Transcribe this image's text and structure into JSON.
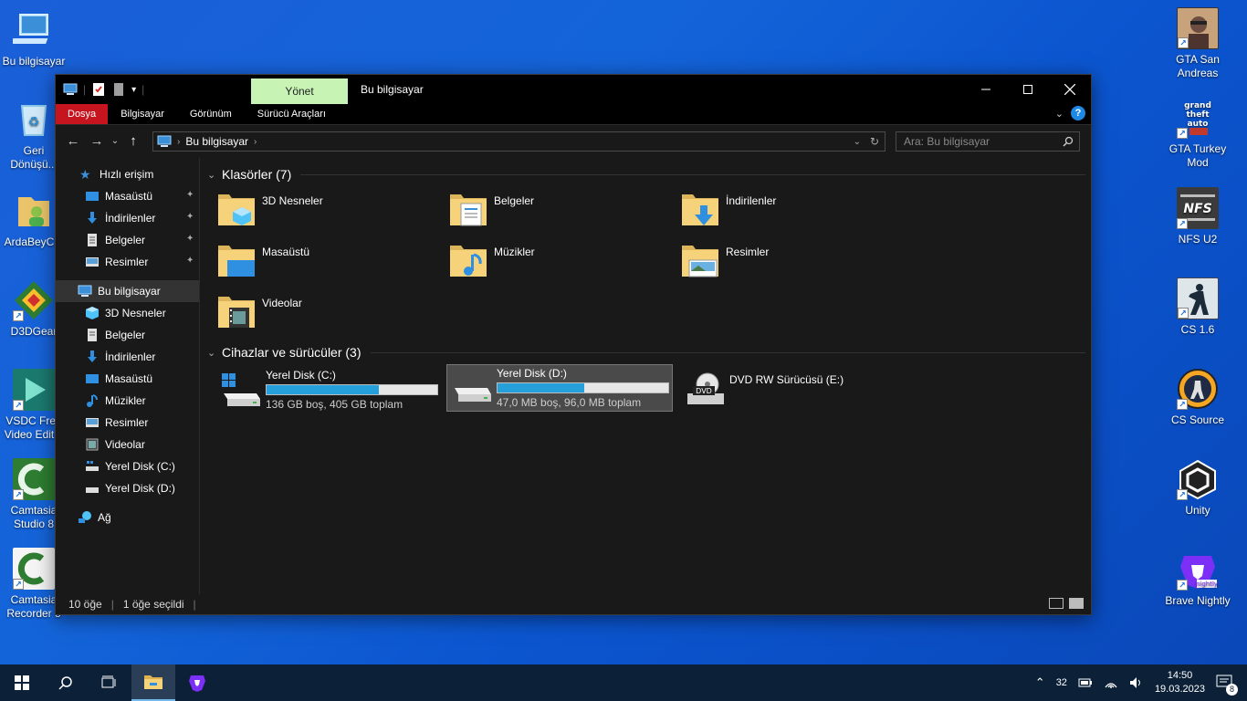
{
  "desktop": {
    "left_icons": [
      {
        "label": "Bu bilgisayar",
        "icon": "computer-icon",
        "color": "#5ab0f0"
      },
      {
        "label": "Geri Dönüşü...",
        "icon": "recycle-bin-icon",
        "color": "#6fb8e8"
      },
      {
        "label": "ArdaBeyC...",
        "icon": "user-folder-icon",
        "color": "#e9c46a"
      },
      {
        "label": "D3DGear",
        "icon": "d3dgear-icon",
        "color": "#2ecc71"
      },
      {
        "label": "VSDC Free Video Edit...",
        "icon": "vsdc-icon",
        "color": "#1abc9c"
      },
      {
        "label": "Camtasia Studio 8",
        "icon": "camtasia-icon",
        "color": "#4caf50"
      },
      {
        "label": "Camtasia Recorder 8",
        "icon": "camtasia-recorder-icon",
        "color": "#4caf50"
      }
    ],
    "right_icons": [
      {
        "label": "GTA San Andreas",
        "icon": "gta-sa-icon",
        "color": "#8b5a2b"
      },
      {
        "label": "GTA Turkey Mod",
        "icon": "gta-turkey-icon",
        "color": "#c0392b"
      },
      {
        "label": "NFS U2",
        "icon": "nfs-icon",
        "color": "#555555"
      },
      {
        "label": "CS 1.6",
        "icon": "cs16-icon",
        "color": "#2c3e50"
      },
      {
        "label": "CS Source",
        "icon": "cs-source-icon",
        "color": "#e67e22"
      },
      {
        "label": "Unity",
        "icon": "unity-icon",
        "color": "#222222"
      },
      {
        "label": "Brave Nightly",
        "icon": "brave-nightly-icon",
        "color": "#7b2ff7"
      }
    ]
  },
  "window": {
    "title": "Bu bilgisayar",
    "context_tab": "Yönet",
    "context_tab_color": "#c7f3b4",
    "ribbon_tabs": [
      "Dosya",
      "Bilgisayar",
      "Görünüm",
      "Sürücü Araçları"
    ],
    "file_tab_color": "#c71520",
    "address_path": "Bu bilgisayar",
    "search_placeholder": "Ara: Bu bilgisayar",
    "help_label": "?"
  },
  "nav": {
    "quick_access": "Hızlı erişim",
    "quick_items": [
      "Masaüstü",
      "İndirilenler",
      "Belgeler",
      "Resimler"
    ],
    "this_pc": "Bu bilgisayar",
    "pc_items": [
      "3D Nesneler",
      "Belgeler",
      "İndirilenler",
      "Masaüstü",
      "Müzikler",
      "Resimler",
      "Videolar",
      "Yerel Disk (C:)",
      "Yerel Disk (D:)"
    ],
    "network": "Ağ"
  },
  "folders": {
    "heading": "Klasörler (7)",
    "items": [
      "3D Nesneler",
      "Belgeler",
      "İndirilenler",
      "Masaüstü",
      "Müzikler",
      "Resimler",
      "Videolar"
    ]
  },
  "devices": {
    "heading": "Cihazlar ve sürücüler (3)",
    "drives": [
      {
        "name": "Yerel Disk (C:)",
        "info": "136 GB boş, 405 GB toplam",
        "used_fraction": 0.66
      },
      {
        "name": "Yerel Disk (D:)",
        "info": "47,0 MB boş, 96,0 MB toplam",
        "used_fraction": 0.51
      },
      {
        "name": "DVD RW Sürücüsü (E:)",
        "info": ""
      }
    ],
    "dvd_label": "DVD"
  },
  "status": {
    "count": "10 öğe",
    "selected": "1 öğe seçildi"
  },
  "taskbar": {
    "time": "14:50",
    "date": "19.03.2023",
    "temp": "32",
    "notification_count": "8"
  }
}
